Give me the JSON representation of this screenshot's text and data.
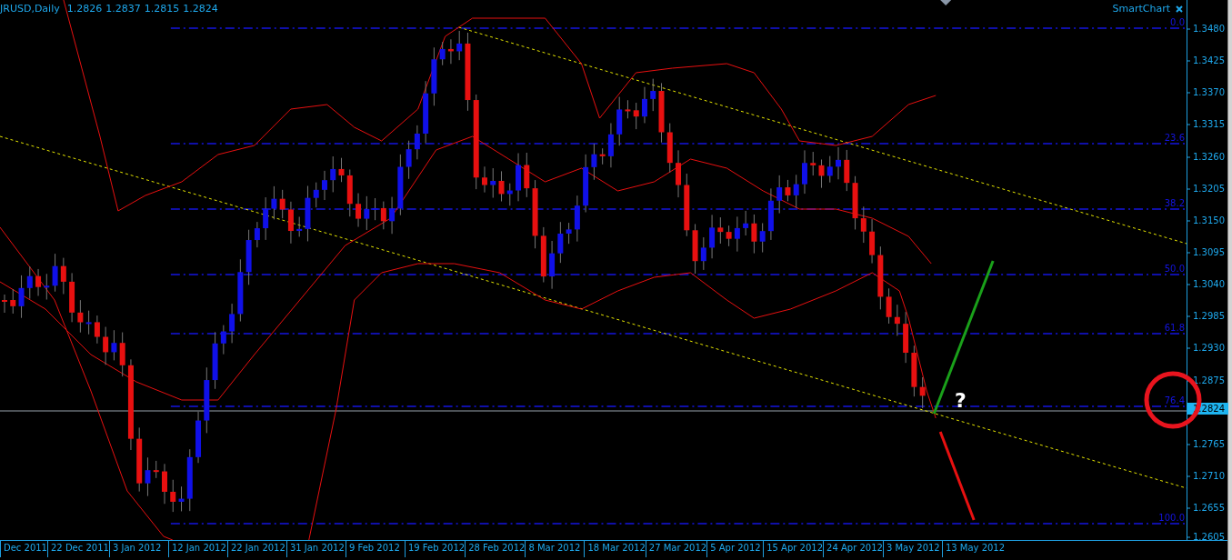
{
  "header": {
    "symbol": "JRUSD,Daily",
    "quotes": [
      "1.2826",
      "1.2837",
      "1.2815",
      "1.2824"
    ]
  },
  "indicator": {
    "label": "SmartChart"
  },
  "fibonacci_levels": [
    {
      "label": "0.0"
    },
    {
      "label": "23.6"
    },
    {
      "label": "38.2"
    },
    {
      "label": "50.0"
    },
    {
      "label": "61.8"
    },
    {
      "label": "76.4"
    },
    {
      "label": "100.0"
    }
  ],
  "annotation": {
    "text": "?"
  },
  "price_axis": {
    "ticks": [
      "1.3480",
      "1.3425",
      "1.3370",
      "1.3315",
      "1.3260",
      "1.3205",
      "1.3150",
      "1.3095",
      "1.3040",
      "1.2985",
      "1.2930",
      "1.2875",
      "1.2765",
      "1.2710",
      "1.2655",
      "1.2605"
    ],
    "current_price": "1.2824"
  },
  "time_axis": {
    "ticks": [
      "Dec 2011",
      "22 Dec 2011",
      "3 Jan 2012",
      "12 Jan 2012",
      "22 Jan 2012",
      "31 Jan 2012",
      "9 Feb 2012",
      "19 Feb 2012",
      "28 Feb 2012",
      "8 Mar 2012",
      "18 Mar 2012",
      "27 Mar 2012",
      "5 Apr 2012",
      "15 Apr 2012",
      "24 Apr 2012",
      "3 May 2012",
      "13 May 2012"
    ]
  }
}
